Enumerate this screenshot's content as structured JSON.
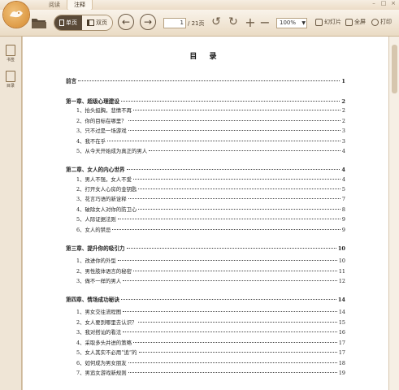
{
  "tabs": [
    "阅读",
    "注释"
  ],
  "toolbar": {
    "single_page": "单页",
    "double_page": "双页",
    "current_page": "1",
    "total_pages": "/ 21页",
    "zoom": "100%",
    "slideshow": "幻灯片",
    "fullscreen": "全屏",
    "print": "打印"
  },
  "sidebar": {
    "bookmark": "书签",
    "contents": "目录"
  },
  "toc": {
    "title": "目 录",
    "entries": [
      {
        "text": "前言",
        "page": "1",
        "chapter": true
      },
      {
        "text": "第一章、超级心理建设",
        "page": "2",
        "chapter": true
      },
      {
        "text": "1、抬头挺胸，悲情不再",
        "page": "2",
        "chapter": false
      },
      {
        "text": "2、你的目标在哪里？",
        "page": "2",
        "chapter": false
      },
      {
        "text": "3、只不过是一场游戏",
        "page": "3",
        "chapter": false
      },
      {
        "text": "4、我不在乎",
        "page": "3",
        "chapter": false
      },
      {
        "text": "5、从今天开始成为真正的男人",
        "page": "4",
        "chapter": false
      },
      {
        "text": "第二章、女人的内心世界",
        "page": "4",
        "chapter": true
      },
      {
        "text": "1、男人不强，女人不爱",
        "page": "4",
        "chapter": false
      },
      {
        "text": "2、打开女人心房的金钥匙",
        "page": "5",
        "chapter": false
      },
      {
        "text": "3、花言巧语的新诠释",
        "page": "7",
        "chapter": false
      },
      {
        "text": "4、破除女人对你的防卫心",
        "page": "8",
        "chapter": false
      },
      {
        "text": "5、人际证据法则",
        "page": "9",
        "chapter": false
      },
      {
        "text": "6、女人的禁忌",
        "page": "9",
        "chapter": false
      },
      {
        "text": "第三章、提升你的吸引力",
        "page": "10",
        "chapter": true
      },
      {
        "text": "1、改进你的外型",
        "page": "10",
        "chapter": false
      },
      {
        "text": "2、男性肢体语言的秘密",
        "page": "11",
        "chapter": false
      },
      {
        "text": "3、做不一样的男人",
        "page": "12",
        "chapter": false
      },
      {
        "text": "第四章、情场成功秘诀",
        "page": "14",
        "chapter": true
      },
      {
        "text": "1、男女交往流程图",
        "page": "14",
        "chapter": false
      },
      {
        "text": "2、女人要到哪里去认识？",
        "page": "15",
        "chapter": false
      },
      {
        "text": "3、我对搭讪的看法",
        "page": "16",
        "chapter": false
      },
      {
        "text": "4、采取多头并进的策略",
        "page": "17",
        "chapter": false
      },
      {
        "text": "5、女人其实不必用“追”的",
        "page": "17",
        "chapter": false
      },
      {
        "text": "6、如何成为男女朋友",
        "page": "18",
        "chapter": false
      },
      {
        "text": "7、男追女游戏新规则",
        "page": "19",
        "chapter": false
      }
    ]
  }
}
